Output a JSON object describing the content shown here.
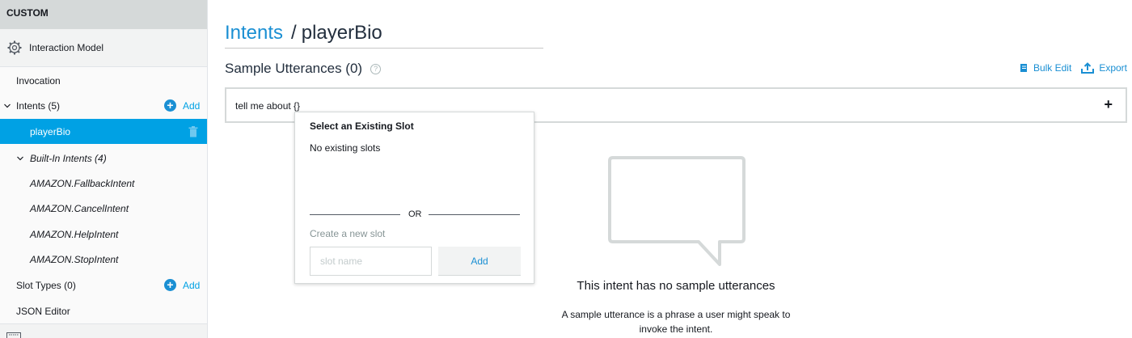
{
  "sidebar": {
    "section_label": "CUSTOM",
    "interaction_model_label": "Interaction Model",
    "invocation_label": "Invocation",
    "intents_label": "Intents (5)",
    "intents_add_label": "Add",
    "selected_intent_label": "playerBio",
    "builtin_label": "Built-In Intents (4)",
    "builtin_items": [
      "AMAZON.FallbackIntent",
      "AMAZON.CancelIntent",
      "AMAZON.HelpIntent",
      "AMAZON.StopIntent"
    ],
    "slot_types_label": "Slot Types (0)",
    "slot_types_add_label": "Add",
    "json_editor_label": "JSON Editor"
  },
  "header": {
    "breadcrumb_link": "Intents",
    "breadcrumb_separator": "/",
    "intent_name": "playerBio"
  },
  "sample_utterances": {
    "title": "Sample Utterances (0)",
    "help_glyph": "?",
    "bulk_edit_label": "Bulk Edit",
    "export_label": "Export",
    "input_value": "tell me about {}",
    "add_glyph": "+"
  },
  "slot_popup": {
    "title": "Select an Existing Slot",
    "no_slots_text": "No existing slots",
    "or_text": "OR",
    "create_label": "Create a new slot",
    "slot_name_placeholder": "slot name",
    "add_button_label": "Add"
  },
  "empty_state": {
    "title": "This intent has no sample utterances",
    "description": "A sample utterance is a phrase a user might speak to invoke the intent.",
    "icon": "speech-bubble-icon"
  },
  "colors": {
    "accent": "#1a8fd3",
    "selected_bg": "#00a1e4",
    "sidebar_header_bg": "#d5d9d9"
  }
}
